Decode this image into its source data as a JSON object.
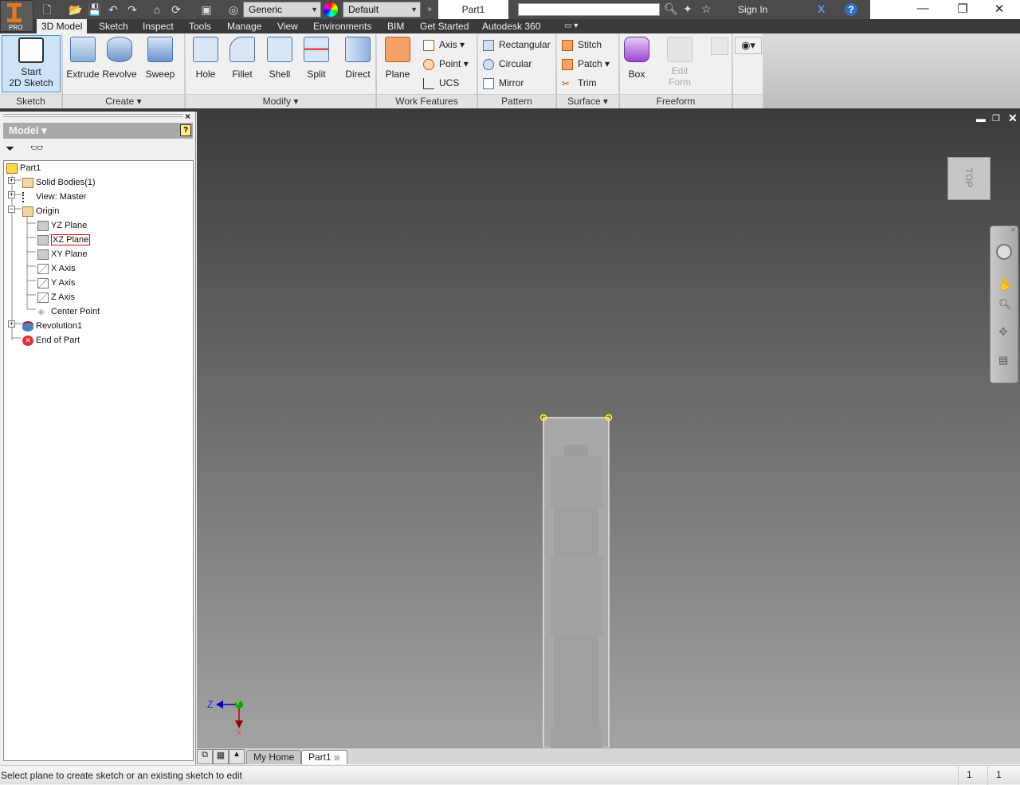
{
  "app": {
    "badge": "PRO",
    "doc_title": "Part1"
  },
  "qat": {
    "material": "Generic",
    "appearance": "Default"
  },
  "help": {
    "sign_in": "Sign In"
  },
  "tabs": [
    "3D Model",
    "Sketch",
    "Inspect",
    "Tools",
    "Manage",
    "View",
    "Environments",
    "BIM",
    "Get Started",
    "Autodesk 360"
  ],
  "ribbon": {
    "sketch": {
      "label": "Sketch",
      "start": "Start",
      "start2": "2D Sketch"
    },
    "create": {
      "label": "Create",
      "extrude": "Extrude",
      "revolve": "Revolve",
      "sweep": "Sweep"
    },
    "modify": {
      "label": "Modify",
      "hole": "Hole",
      "fillet": "Fillet",
      "shell": "Shell",
      "split": "Split",
      "direct": "Direct"
    },
    "work": {
      "label": "Work Features",
      "plane": "Plane",
      "axis": "Axis",
      "point": "Point",
      "ucs": "UCS"
    },
    "pattern": {
      "label": "Pattern",
      "rect": "Rectangular",
      "circ": "Circular",
      "mirror": "Mirror"
    },
    "surface": {
      "label": "Surface",
      "stitch": "Stitch",
      "patch": "Patch",
      "trim": "Trim"
    },
    "freeform": {
      "label": "Freeform",
      "box": "Box",
      "edit": "Edit",
      "form": "Form"
    }
  },
  "browser": {
    "title": "Model",
    "tree": [
      "Part1",
      "Solid Bodies(1)",
      "View: Master",
      "Origin",
      "YZ Plane",
      "XZ Plane",
      "XY Plane",
      "X Axis",
      "Y Axis",
      "Z Axis",
      "Center Point",
      "Revolution1",
      "End of Part"
    ]
  },
  "viewport": {
    "viewcube_face": "TOP",
    "triad": {
      "z": "Z",
      "y": "Y",
      "x": "X"
    }
  },
  "doc_tabs": [
    "My Home",
    "Part1"
  ],
  "status": {
    "message": "Select plane to create sketch or an existing sketch to edit",
    "count1": "1",
    "count2": "1"
  },
  "colors": {
    "accent_orange": "#e07a20",
    "highlight_border": "#e00000",
    "selection": "#cde3f7"
  }
}
